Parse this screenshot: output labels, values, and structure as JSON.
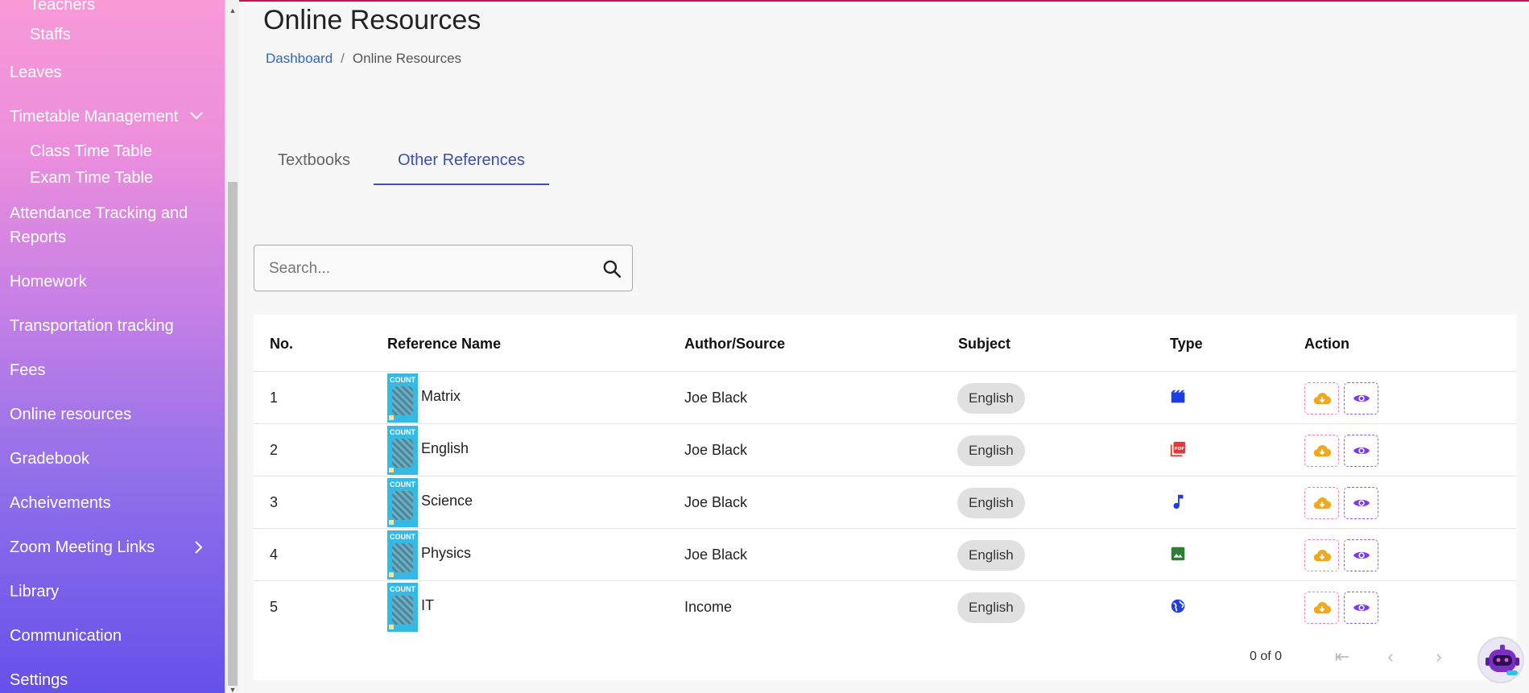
{
  "sidebar": {
    "items": [
      {
        "label": "Teachers"
      },
      {
        "label": "Staffs"
      },
      {
        "label": "Leaves"
      },
      {
        "label": "Timetable Management"
      },
      {
        "label": "Class Time Table"
      },
      {
        "label": "Exam Time Table"
      },
      {
        "label": "Attendance Tracking and"
      },
      {
        "label": "Reports"
      },
      {
        "label": "Homework"
      },
      {
        "label": "Transportation tracking"
      },
      {
        "label": "Fees"
      },
      {
        "label": "Online resources"
      },
      {
        "label": "Gradebook"
      },
      {
        "label": "Acheivements"
      },
      {
        "label": "Zoom Meeting Links"
      },
      {
        "label": "Library"
      },
      {
        "label": "Communication"
      },
      {
        "label": "Settings"
      }
    ]
  },
  "header": {
    "title": "Online Resources",
    "breadcrumb": {
      "home": "Dashboard",
      "separator": "/",
      "current": "Online Resources"
    }
  },
  "tabs": [
    {
      "label": "Textbooks",
      "active": false
    },
    {
      "label": "Other References",
      "active": true
    }
  ],
  "search": {
    "placeholder": "Search..."
  },
  "table": {
    "columns": [
      "No.",
      "Reference Name",
      "Author/Source",
      "Subject",
      "Type",
      "Action"
    ],
    "rows": [
      {
        "no": "1",
        "name": "Matrix",
        "author": "Joe Black",
        "subject": "English",
        "type": "video-icon",
        "type_color": "#1d3ee6"
      },
      {
        "no": "2",
        "name": "English",
        "author": "Joe Black",
        "subject": "English",
        "type": "pdf-icon",
        "type_color": "#e53935"
      },
      {
        "no": "3",
        "name": "Science",
        "author": "Joe Black",
        "subject": "English",
        "type": "audio-icon",
        "type_color": "#1d3ee6"
      },
      {
        "no": "4",
        "name": "Physics",
        "author": "Joe Black",
        "subject": "English",
        "type": "image-icon",
        "type_color": "#2e7d32"
      },
      {
        "no": "5",
        "name": "IT",
        "author": "Income",
        "subject": "English",
        "type": "web-icon",
        "type_color": "#1d3ee6"
      }
    ],
    "thumbnail_text": "COUNT",
    "pagination": {
      "label": "0 of 0"
    }
  },
  "colors": {
    "accent": "#3a4fb0",
    "link": "#2a67c7",
    "download_icon": "#f0a81e",
    "view_icon": "#7c3aed"
  }
}
